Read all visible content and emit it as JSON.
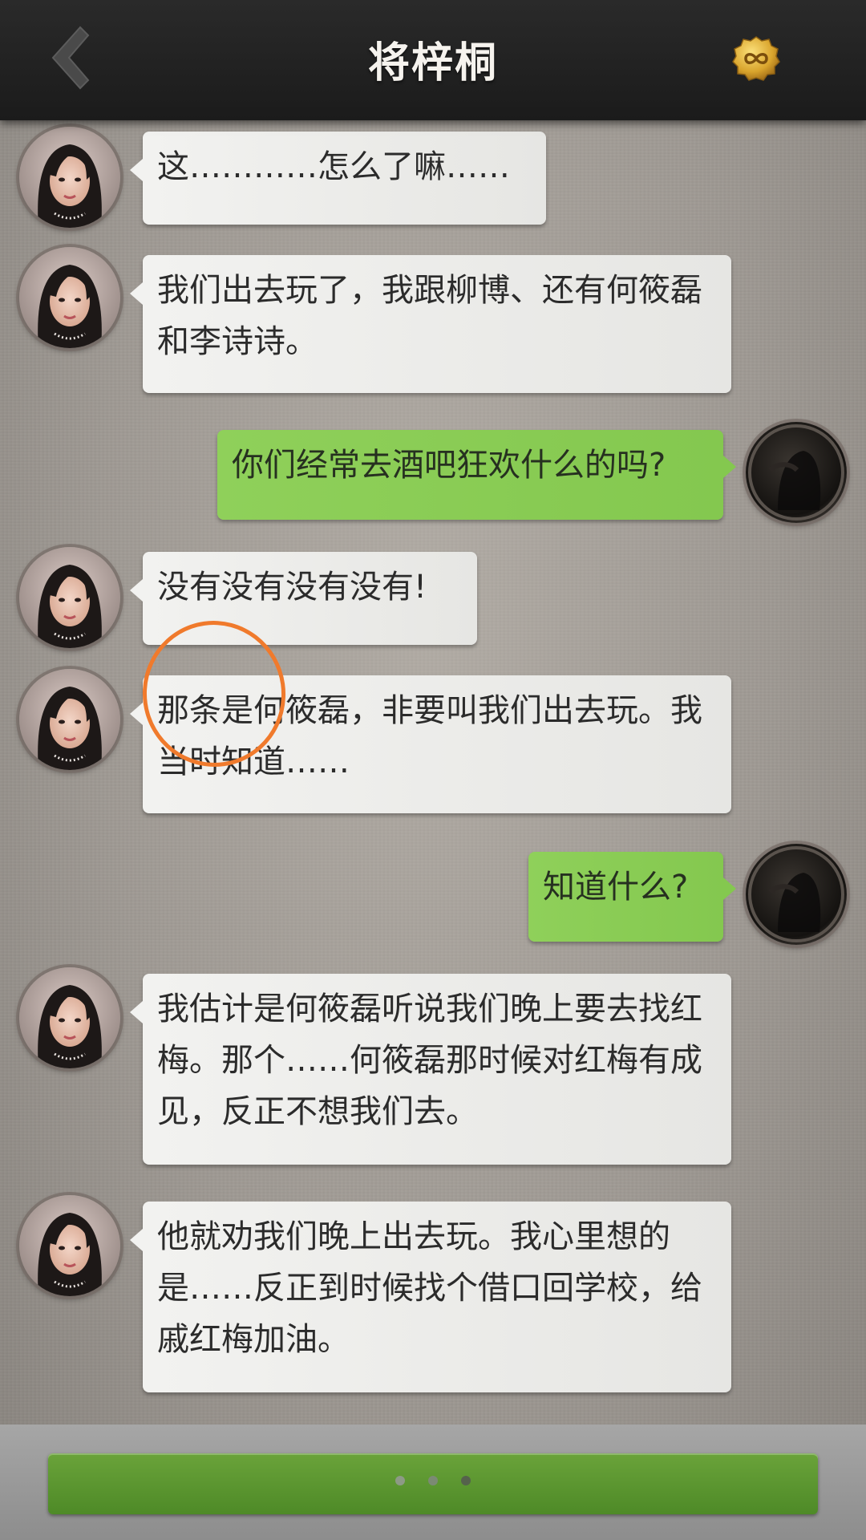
{
  "header": {
    "title": "将梓桐",
    "back_icon": "chevron-left-icon",
    "coin_icon": "infinity-coin-icon"
  },
  "messages": [
    {
      "side": "npc",
      "text": "这…………怎么了嘛……"
    },
    {
      "side": "npc",
      "text": "我们出去玩了，我跟柳博、还有何筱磊和李诗诗。"
    },
    {
      "side": "me",
      "text": "你们经常去酒吧狂欢什么的吗?"
    },
    {
      "side": "npc",
      "text": "没有没有没有没有!"
    },
    {
      "side": "npc",
      "text": "那条是何筱磊，非要叫我们出去玩。我当时知道……"
    },
    {
      "side": "me",
      "text": "知道什么?"
    },
    {
      "side": "npc",
      "text": "我估计是何筱磊听说我们晚上要去找红梅。那个……何筱磊那时候对红梅有成见，反正不想我们去。"
    },
    {
      "side": "npc",
      "text": "他就劝我们晚上出去玩。我心里想的是……反正到时候找个借口回学校，给戚红梅加油。"
    }
  ],
  "bottom": {
    "typing_dots": 3
  },
  "colors": {
    "header_bg": "#1f1f1f",
    "npc_bubble": "#eeeeec",
    "me_bubble": "#8bcd55",
    "annotation": "#f07a2c",
    "continue_button": "#5c9631"
  }
}
